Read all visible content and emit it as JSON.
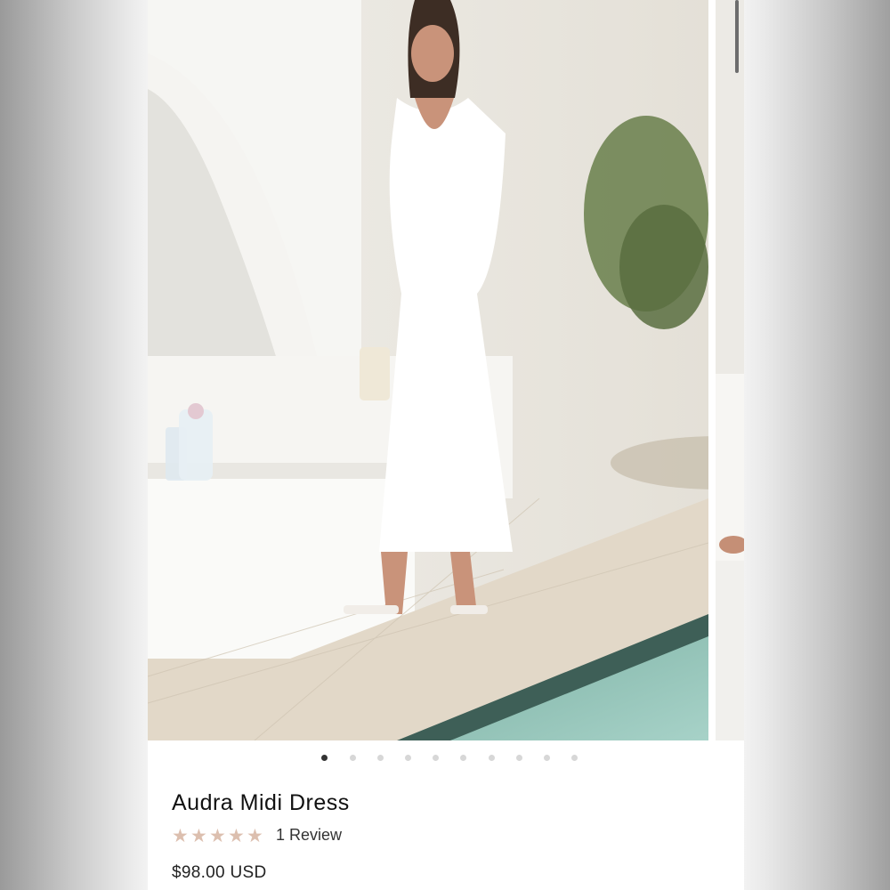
{
  "product": {
    "title": "Audra Midi Dress",
    "review_count_label": "1 Review",
    "price": "$98.00 USD",
    "rating": 5,
    "rating_max": 5,
    "star_color": "#dcbfaf"
  },
  "gallery": {
    "total_images": 10,
    "active_index": 0
  },
  "icons": {
    "star": "star-icon"
  }
}
